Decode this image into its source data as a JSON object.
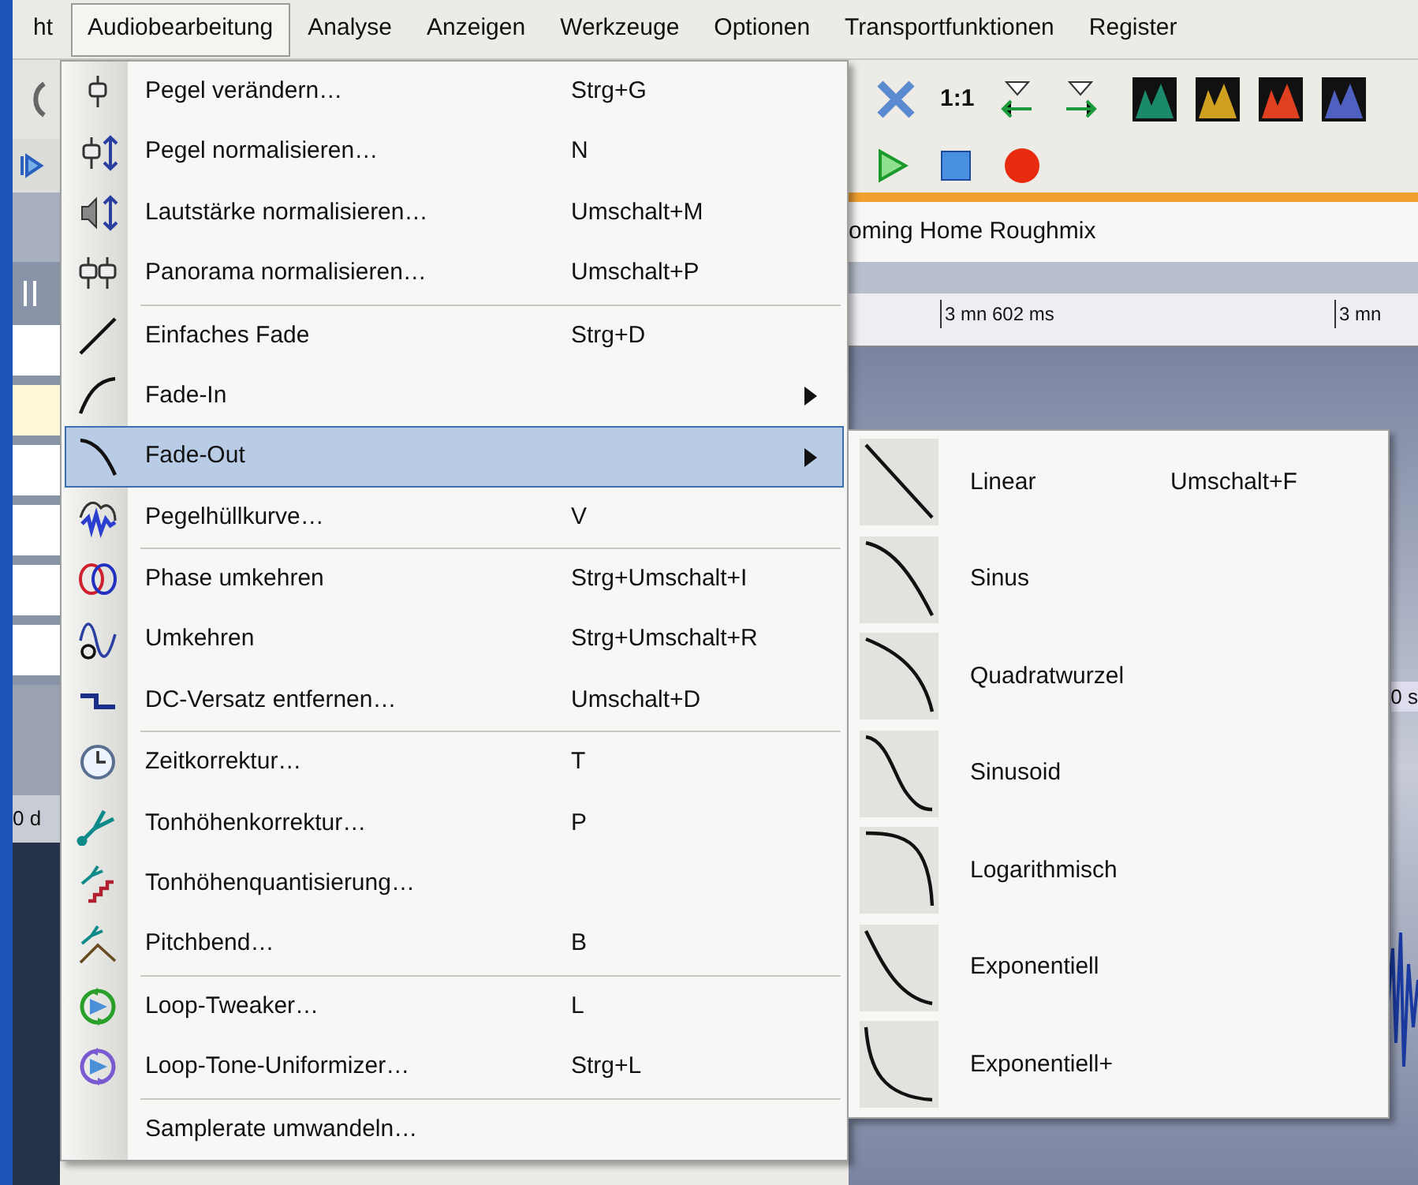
{
  "menubar": [
    {
      "label": "ht",
      "selected": false
    },
    {
      "label": "Audiobearbeitung",
      "selected": true
    },
    {
      "label": "Analyse",
      "selected": false
    },
    {
      "label": "Anzeigen",
      "selected": false
    },
    {
      "label": "Werkzeuge",
      "selected": false
    },
    {
      "label": "Optionen",
      "selected": false
    },
    {
      "label": "Transportfunktionen",
      "selected": false
    },
    {
      "label": "Register",
      "selected": false
    }
  ],
  "toolbar": {
    "zoom_label": "1:1"
  },
  "document_title": "oming Home Roughmix",
  "ruler": [
    "3 mn 602 ms",
    "3 mn"
  ],
  "level_label": "0 d",
  "time_label": "0 s",
  "menu": {
    "items": [
      {
        "kind": "item",
        "label": "Pegel verändern…",
        "shortcut": "Strg+G",
        "submenu": false,
        "selected": false
      },
      {
        "kind": "item",
        "label": "Pegel normalisieren…",
        "shortcut": "N",
        "submenu": false,
        "selected": false
      },
      {
        "kind": "item",
        "label": "Lautstärke normalisieren…",
        "shortcut": "Umschalt+M",
        "submenu": false,
        "selected": false
      },
      {
        "kind": "item",
        "label": "Panorama normalisieren…",
        "shortcut": "Umschalt+P",
        "submenu": false,
        "selected": false
      },
      {
        "kind": "separator"
      },
      {
        "kind": "item",
        "label": "Einfaches Fade",
        "shortcut": "Strg+D",
        "submenu": false,
        "selected": false
      },
      {
        "kind": "item",
        "label": "Fade-In",
        "submenu": true,
        "selected": false
      },
      {
        "kind": "item",
        "label": "Fade-Out",
        "submenu": true,
        "selected": true
      },
      {
        "kind": "item",
        "label": "Pegelhüllkurve…",
        "shortcut": "V",
        "submenu": false,
        "selected": false
      },
      {
        "kind": "separator"
      },
      {
        "kind": "item",
        "label": "Phase umkehren",
        "shortcut": "Strg+Umschalt+I",
        "submenu": false,
        "selected": false
      },
      {
        "kind": "item",
        "label": "Umkehren",
        "shortcut": "Strg+Umschalt+R",
        "submenu": false,
        "selected": false
      },
      {
        "kind": "item",
        "label": "DC-Versatz entfernen…",
        "shortcut": "Umschalt+D",
        "submenu": false,
        "selected": false
      },
      {
        "kind": "separator"
      },
      {
        "kind": "item",
        "label": "Zeitkorrektur…",
        "shortcut": "T",
        "submenu": false,
        "selected": false
      },
      {
        "kind": "item",
        "label": "Tonhöhenkorrektur…",
        "shortcut": "P",
        "submenu": false,
        "selected": false
      },
      {
        "kind": "item",
        "label": "Tonhöhenquantisierung…",
        "submenu": false,
        "selected": false
      },
      {
        "kind": "item",
        "label": "Pitchbend…",
        "shortcut": "B",
        "submenu": false,
        "selected": false
      },
      {
        "kind": "separator"
      },
      {
        "kind": "item",
        "label": "Loop-Tweaker…",
        "shortcut": "L",
        "submenu": false,
        "selected": false
      },
      {
        "kind": "item",
        "label": "Loop-Tone-Uniformizer…",
        "shortcut": "Strg+L",
        "submenu": false,
        "selected": false
      },
      {
        "kind": "separator"
      },
      {
        "kind": "item",
        "label": "Samplerate umwandeln…",
        "submenu": false,
        "selected": false
      }
    ]
  },
  "submenu": {
    "items": [
      {
        "label": "Linear",
        "shortcut": "Umschalt+F",
        "selected": false
      },
      {
        "label": "Sinus",
        "selected": false
      },
      {
        "label": "Quadratwurzel",
        "selected": false
      },
      {
        "label": "Sinusoid",
        "selected": false
      },
      {
        "label": "Logarithmisch",
        "selected": false
      },
      {
        "label": "Exponentiell",
        "selected": false
      },
      {
        "label": "Exponentiell+",
        "selected": false
      }
    ]
  }
}
